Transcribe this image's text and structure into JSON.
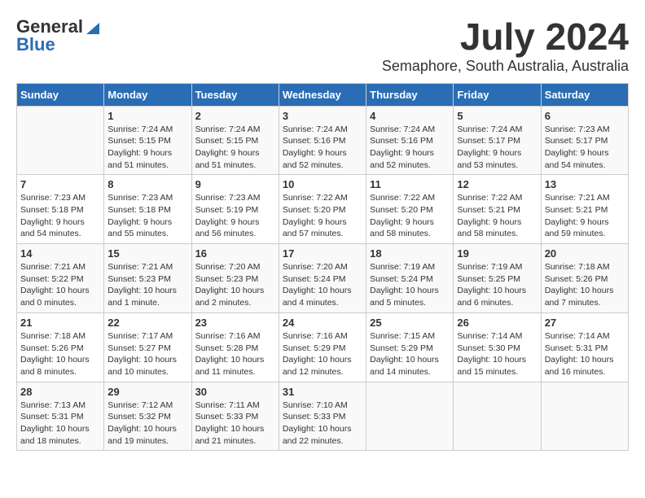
{
  "header": {
    "logo_line1": "General",
    "logo_line2": "Blue",
    "month": "July 2024",
    "location": "Semaphore, South Australia, Australia"
  },
  "days_header": [
    "Sunday",
    "Monday",
    "Tuesday",
    "Wednesday",
    "Thursday",
    "Friday",
    "Saturday"
  ],
  "weeks": [
    [
      {
        "date": "",
        "info": ""
      },
      {
        "date": "1",
        "info": "Sunrise: 7:24 AM\nSunset: 5:15 PM\nDaylight: 9 hours\nand 51 minutes."
      },
      {
        "date": "2",
        "info": "Sunrise: 7:24 AM\nSunset: 5:15 PM\nDaylight: 9 hours\nand 51 minutes."
      },
      {
        "date": "3",
        "info": "Sunrise: 7:24 AM\nSunset: 5:16 PM\nDaylight: 9 hours\nand 52 minutes."
      },
      {
        "date": "4",
        "info": "Sunrise: 7:24 AM\nSunset: 5:16 PM\nDaylight: 9 hours\nand 52 minutes."
      },
      {
        "date": "5",
        "info": "Sunrise: 7:24 AM\nSunset: 5:17 PM\nDaylight: 9 hours\nand 53 minutes."
      },
      {
        "date": "6",
        "info": "Sunrise: 7:23 AM\nSunset: 5:17 PM\nDaylight: 9 hours\nand 54 minutes."
      }
    ],
    [
      {
        "date": "7",
        "info": "Sunrise: 7:23 AM\nSunset: 5:18 PM\nDaylight: 9 hours\nand 54 minutes."
      },
      {
        "date": "8",
        "info": "Sunrise: 7:23 AM\nSunset: 5:18 PM\nDaylight: 9 hours\nand 55 minutes."
      },
      {
        "date": "9",
        "info": "Sunrise: 7:23 AM\nSunset: 5:19 PM\nDaylight: 9 hours\nand 56 minutes."
      },
      {
        "date": "10",
        "info": "Sunrise: 7:22 AM\nSunset: 5:20 PM\nDaylight: 9 hours\nand 57 minutes."
      },
      {
        "date": "11",
        "info": "Sunrise: 7:22 AM\nSunset: 5:20 PM\nDaylight: 9 hours\nand 58 minutes."
      },
      {
        "date": "12",
        "info": "Sunrise: 7:22 AM\nSunset: 5:21 PM\nDaylight: 9 hours\nand 58 minutes."
      },
      {
        "date": "13",
        "info": "Sunrise: 7:21 AM\nSunset: 5:21 PM\nDaylight: 9 hours\nand 59 minutes."
      }
    ],
    [
      {
        "date": "14",
        "info": "Sunrise: 7:21 AM\nSunset: 5:22 PM\nDaylight: 10 hours\nand 0 minutes."
      },
      {
        "date": "15",
        "info": "Sunrise: 7:21 AM\nSunset: 5:23 PM\nDaylight: 10 hours\nand 1 minute."
      },
      {
        "date": "16",
        "info": "Sunrise: 7:20 AM\nSunset: 5:23 PM\nDaylight: 10 hours\nand 2 minutes."
      },
      {
        "date": "17",
        "info": "Sunrise: 7:20 AM\nSunset: 5:24 PM\nDaylight: 10 hours\nand 4 minutes."
      },
      {
        "date": "18",
        "info": "Sunrise: 7:19 AM\nSunset: 5:24 PM\nDaylight: 10 hours\nand 5 minutes."
      },
      {
        "date": "19",
        "info": "Sunrise: 7:19 AM\nSunset: 5:25 PM\nDaylight: 10 hours\nand 6 minutes."
      },
      {
        "date": "20",
        "info": "Sunrise: 7:18 AM\nSunset: 5:26 PM\nDaylight: 10 hours\nand 7 minutes."
      }
    ],
    [
      {
        "date": "21",
        "info": "Sunrise: 7:18 AM\nSunset: 5:26 PM\nDaylight: 10 hours\nand 8 minutes."
      },
      {
        "date": "22",
        "info": "Sunrise: 7:17 AM\nSunset: 5:27 PM\nDaylight: 10 hours\nand 10 minutes."
      },
      {
        "date": "23",
        "info": "Sunrise: 7:16 AM\nSunset: 5:28 PM\nDaylight: 10 hours\nand 11 minutes."
      },
      {
        "date": "24",
        "info": "Sunrise: 7:16 AM\nSunset: 5:29 PM\nDaylight: 10 hours\nand 12 minutes."
      },
      {
        "date": "25",
        "info": "Sunrise: 7:15 AM\nSunset: 5:29 PM\nDaylight: 10 hours\nand 14 minutes."
      },
      {
        "date": "26",
        "info": "Sunrise: 7:14 AM\nSunset: 5:30 PM\nDaylight: 10 hours\nand 15 minutes."
      },
      {
        "date": "27",
        "info": "Sunrise: 7:14 AM\nSunset: 5:31 PM\nDaylight: 10 hours\nand 16 minutes."
      }
    ],
    [
      {
        "date": "28",
        "info": "Sunrise: 7:13 AM\nSunset: 5:31 PM\nDaylight: 10 hours\nand 18 minutes."
      },
      {
        "date": "29",
        "info": "Sunrise: 7:12 AM\nSunset: 5:32 PM\nDaylight: 10 hours\nand 19 minutes."
      },
      {
        "date": "30",
        "info": "Sunrise: 7:11 AM\nSunset: 5:33 PM\nDaylight: 10 hours\nand 21 minutes."
      },
      {
        "date": "31",
        "info": "Sunrise: 7:10 AM\nSunset: 5:33 PM\nDaylight: 10 hours\nand 22 minutes."
      },
      {
        "date": "",
        "info": ""
      },
      {
        "date": "",
        "info": ""
      },
      {
        "date": "",
        "info": ""
      }
    ]
  ]
}
